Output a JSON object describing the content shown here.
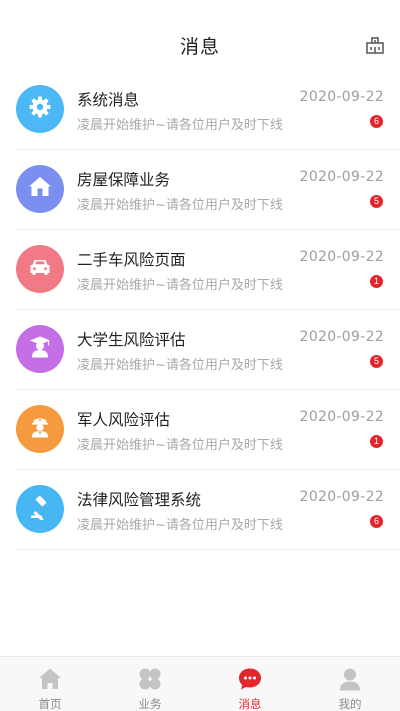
{
  "header": {
    "title": "消息"
  },
  "messages": [
    {
      "name": "系统消息",
      "desc": "凌晨开始维护~请各位用户及时下线",
      "date": "2020-09-22",
      "badge": "6",
      "icon": "gear-icon",
      "color": "#4cb8f5"
    },
    {
      "name": "房屋保障业务",
      "desc": "凌晨开始维护~请各位用户及时下线",
      "date": "2020-09-22",
      "badge": "5",
      "icon": "house-icon",
      "color": "#7b8ff0"
    },
    {
      "name": "二手车风险页面",
      "desc": "凌晨开始维护~请各位用户及时下线",
      "date": "2020-09-22",
      "badge": "1",
      "icon": "car-icon",
      "color": "#f27a86"
    },
    {
      "name": "大学生风险评估",
      "desc": "凌晨开始维护~请各位用户及时下线",
      "date": "2020-09-22",
      "badge": "5",
      "icon": "graduate-icon",
      "color": "#c46fe6"
    },
    {
      "name": "军人风险评估",
      "desc": "凌晨开始维护~请各位用户及时下线",
      "date": "2020-09-22",
      "badge": "1",
      "icon": "soldier-icon",
      "color": "#f59a3e"
    },
    {
      "name": "法律风险管理系统",
      "desc": "凌晨开始维护~请各位用户及时下线",
      "date": "2020-09-22",
      "badge": "6",
      "icon": "gavel-icon",
      "color": "#46b7f3"
    }
  ],
  "tabbar": {
    "tabs": [
      {
        "label": "首页",
        "icon": "home-icon",
        "active": false
      },
      {
        "label": "业务",
        "icon": "clover-icon",
        "active": false
      },
      {
        "label": "消息",
        "icon": "chat-icon",
        "active": true
      },
      {
        "label": "我的",
        "icon": "user-icon",
        "active": false
      }
    ]
  },
  "colors": {
    "accent": "#e3262c",
    "inactive": "#8a8a8a"
  }
}
